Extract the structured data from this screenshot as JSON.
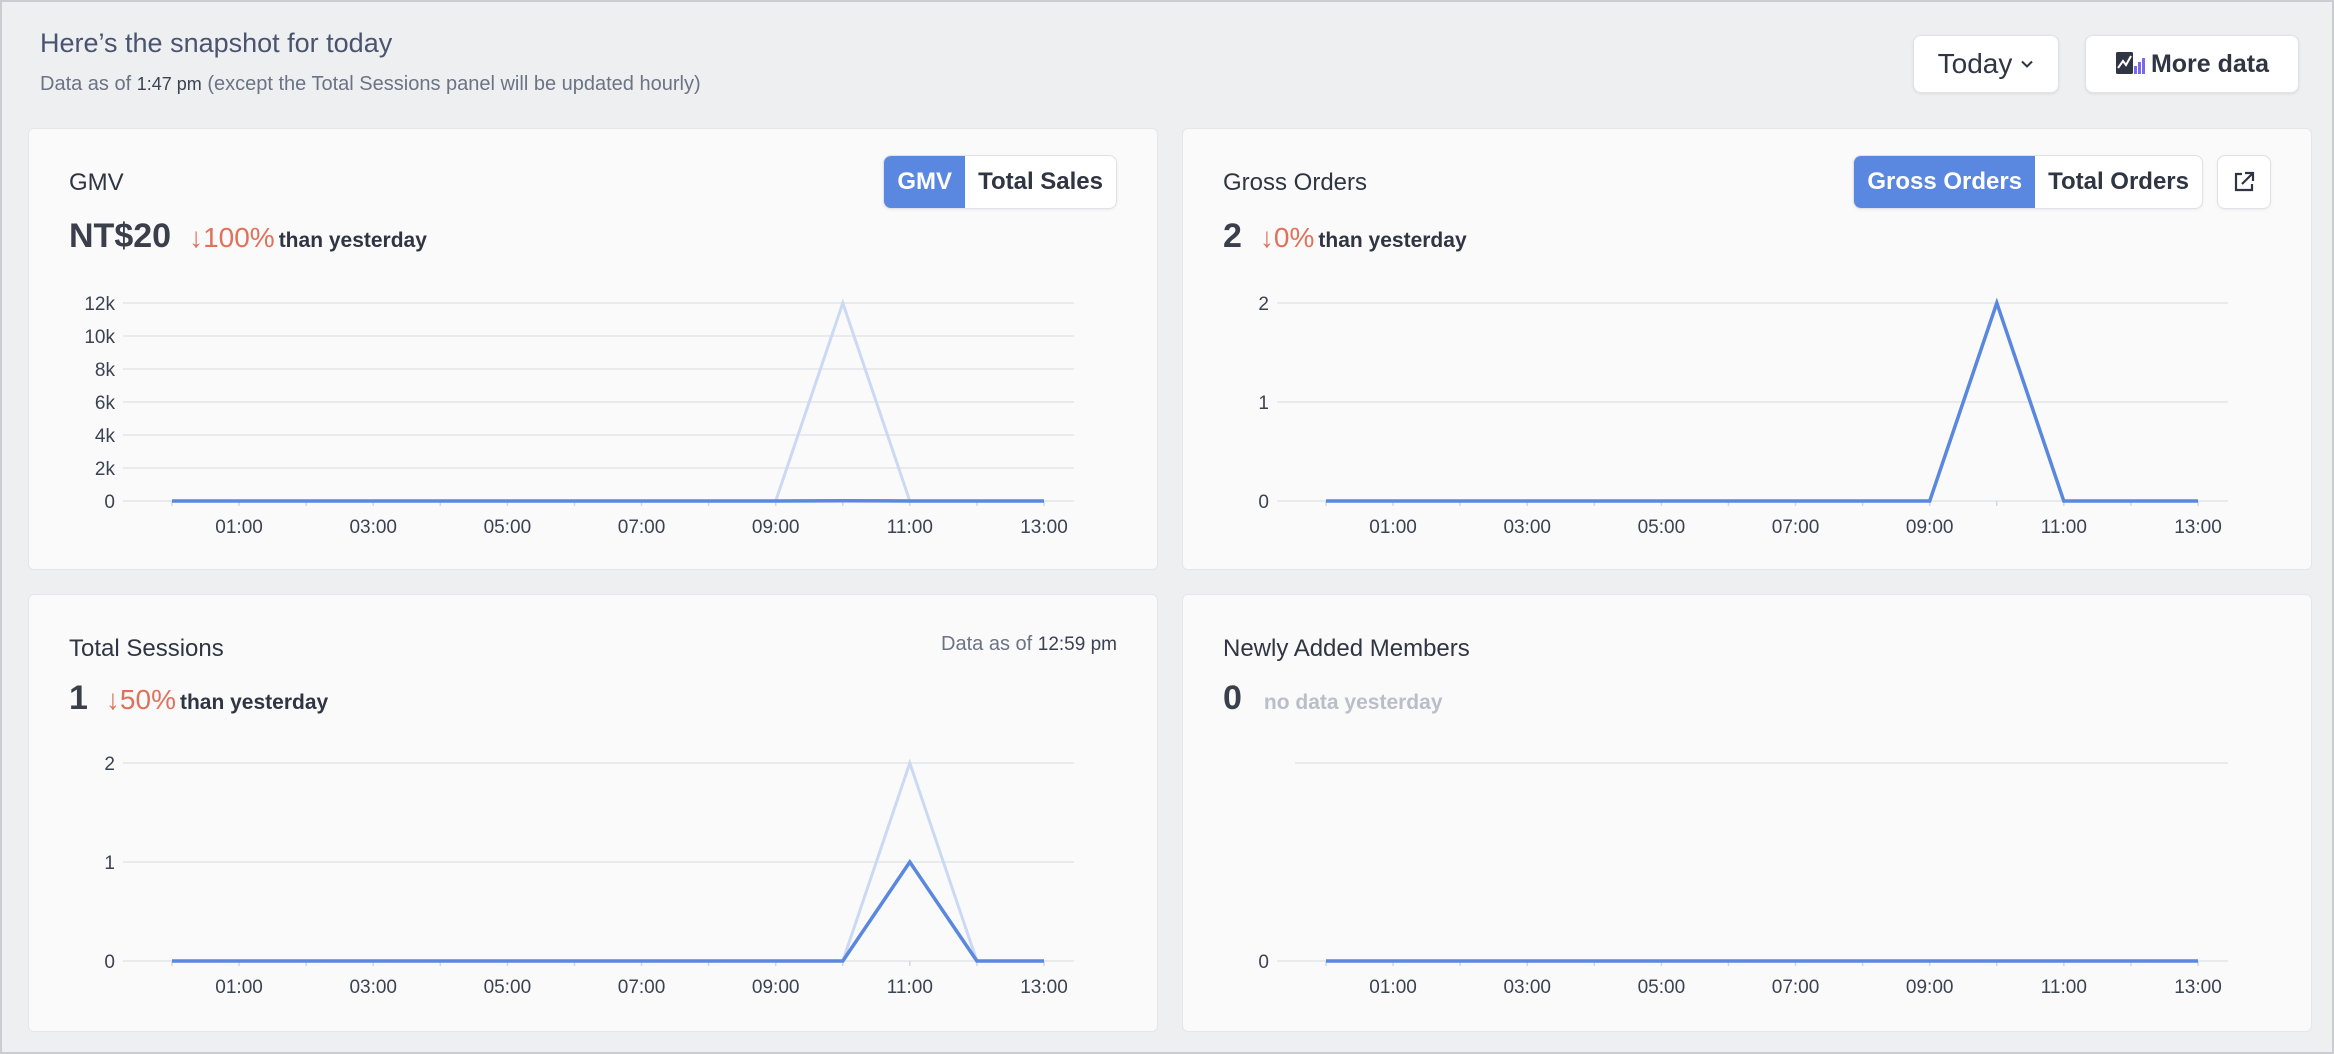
{
  "header": {
    "title": "Here’s the snapshot for today",
    "subtitle_prefix": "Data as of",
    "subtitle_time": "1:47 pm",
    "subtitle_suffix": "(except the Total Sessions panel will be updated hourly)"
  },
  "controls": {
    "period_label": "Today",
    "more_data_label": "More data"
  },
  "colors": {
    "accent": "#5a87e0",
    "comparison_line": "#cbd9f3",
    "decrease": "#e0725c"
  },
  "panels": {
    "gmv": {
      "title": "GMV",
      "value": "NT$20",
      "change": "↓100%",
      "note": "than yesterday",
      "toggle": [
        "GMV",
        "Total Sales"
      ]
    },
    "gross_orders": {
      "title": "Gross Orders",
      "value": "2",
      "change": "↓0%",
      "note": "than yesterday",
      "toggle": [
        "Gross Orders",
        "Total Orders"
      ]
    },
    "sessions": {
      "title": "Total Sessions",
      "value": "1",
      "change": "↓50%",
      "note": "than yesterday",
      "asof_prefix": "Data as of",
      "asof_time": "12:59 pm"
    },
    "members": {
      "title": "Newly Added Members",
      "value": "0",
      "note": "no data yesterday"
    }
  },
  "chart_data": [
    {
      "id": "gmv",
      "type": "line",
      "x": [
        "00:00",
        "01:00",
        "02:00",
        "03:00",
        "04:00",
        "05:00",
        "06:00",
        "07:00",
        "08:00",
        "09:00",
        "10:00",
        "11:00",
        "12:00",
        "13:00"
      ],
      "xticks": [
        "01:00",
        "03:00",
        "05:00",
        "07:00",
        "09:00",
        "11:00",
        "13:00"
      ],
      "yticks": [
        0,
        2000,
        4000,
        6000,
        8000,
        10000,
        12000
      ],
      "ytick_labels": [
        "0",
        "2k",
        "4k",
        "6k",
        "8k",
        "10k",
        "12k"
      ],
      "ylim": [
        0,
        12000
      ],
      "series": [
        {
          "role": "yesterday",
          "values": [
            0,
            0,
            0,
            0,
            0,
            0,
            0,
            0,
            0,
            0,
            12000,
            0,
            0,
            0
          ]
        },
        {
          "role": "today",
          "values": [
            0,
            0,
            0,
            0,
            0,
            0,
            0,
            0,
            0,
            0,
            20,
            0,
            0,
            0
          ]
        }
      ]
    },
    {
      "id": "gross_orders",
      "type": "line",
      "x": [
        "00:00",
        "01:00",
        "02:00",
        "03:00",
        "04:00",
        "05:00",
        "06:00",
        "07:00",
        "08:00",
        "09:00",
        "10:00",
        "11:00",
        "12:00",
        "13:00"
      ],
      "xticks": [
        "01:00",
        "03:00",
        "05:00",
        "07:00",
        "09:00",
        "11:00",
        "13:00"
      ],
      "yticks": [
        0,
        1,
        2
      ],
      "ytick_labels": [
        "0",
        "1",
        "2"
      ],
      "ylim": [
        0,
        2
      ],
      "series": [
        {
          "role": "yesterday",
          "values": [
            0,
            0,
            0,
            0,
            0,
            0,
            0,
            0,
            0,
            0,
            2,
            0,
            0,
            0
          ]
        },
        {
          "role": "today",
          "values": [
            0,
            0,
            0,
            0,
            0,
            0,
            0,
            0,
            0,
            0,
            2,
            0,
            0,
            0
          ]
        }
      ]
    },
    {
      "id": "sessions",
      "type": "line",
      "x": [
        "00:00",
        "01:00",
        "02:00",
        "03:00",
        "04:00",
        "05:00",
        "06:00",
        "07:00",
        "08:00",
        "09:00",
        "10:00",
        "11:00",
        "12:00",
        "13:00"
      ],
      "xticks": [
        "01:00",
        "03:00",
        "05:00",
        "07:00",
        "09:00",
        "11:00",
        "13:00"
      ],
      "yticks": [
        0,
        1,
        2
      ],
      "ytick_labels": [
        "0",
        "1",
        "2"
      ],
      "ylim": [
        0,
        2
      ],
      "series": [
        {
          "role": "yesterday",
          "values": [
            0,
            0,
            0,
            0,
            0,
            0,
            0,
            0,
            0,
            0,
            0,
            2,
            0,
            0
          ]
        },
        {
          "role": "today",
          "values": [
            0,
            0,
            0,
            0,
            0,
            0,
            0,
            0,
            0,
            0,
            0,
            1,
            0,
            0
          ]
        }
      ]
    },
    {
      "id": "members",
      "type": "line",
      "x": [
        "00:00",
        "01:00",
        "02:00",
        "03:00",
        "04:00",
        "05:00",
        "06:00",
        "07:00",
        "08:00",
        "09:00",
        "10:00",
        "11:00",
        "12:00",
        "13:00"
      ],
      "xticks": [
        "01:00",
        "03:00",
        "05:00",
        "07:00",
        "09:00",
        "11:00",
        "13:00"
      ],
      "yticks": [
        0
      ],
      "ytick_labels": [
        "0"
      ],
      "ylim": [
        0,
        1
      ],
      "series": [
        {
          "role": "today",
          "values": [
            0,
            0,
            0,
            0,
            0,
            0,
            0,
            0,
            0,
            0,
            0,
            0,
            0,
            0
          ]
        }
      ]
    }
  ]
}
